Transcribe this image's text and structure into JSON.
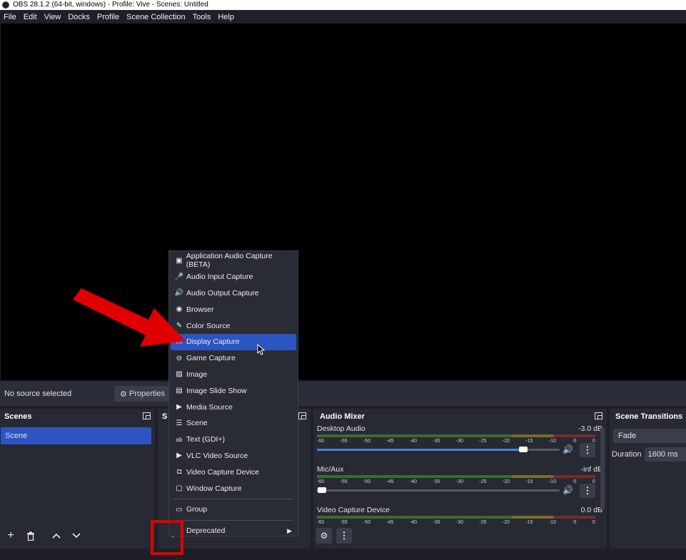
{
  "window": {
    "title": "OBS 28.1.2 (64-bit, windows) - Profile: Vive - Scenes: Untitled"
  },
  "menubar": {
    "items": [
      "File",
      "Edit",
      "View",
      "Docks",
      "Profile",
      "Scene Collection",
      "Tools",
      "Help"
    ]
  },
  "source_bar": {
    "status": "No source selected",
    "properties_label": "Properties"
  },
  "scenes": {
    "title": "Scenes",
    "items": [
      "Scene"
    ]
  },
  "sources": {
    "title_partial": "S"
  },
  "audio_mixer": {
    "title": "Audio Mixer",
    "ticks": [
      "-60",
      "-55",
      "-50",
      "-45",
      "-40",
      "-35",
      "-30",
      "-25",
      "-20",
      "-15",
      "-10",
      "-5",
      "0"
    ],
    "channels": [
      {
        "name": "Desktop Audio",
        "db": "-3.0 dB",
        "volume": 0.85
      },
      {
        "name": "Mic/Aux",
        "db": "-inf dB",
        "volume": 0.02
      },
      {
        "name": "Video Capture Device",
        "db": "0.0 dB",
        "volume": 1.0
      }
    ]
  },
  "transitions": {
    "title": "Scene Transitions",
    "selected": "Fade",
    "duration_label": "Duration",
    "duration_value": "1600 ms"
  },
  "add_source_menu": {
    "items": [
      {
        "label": "Application Audio Capture (BETA)",
        "icon": "app-audio-icon"
      },
      {
        "label": "Audio Input Capture",
        "icon": "microphone-icon"
      },
      {
        "label": "Audio Output Capture",
        "icon": "speaker-icon"
      },
      {
        "label": "Browser",
        "icon": "globe-icon"
      },
      {
        "label": "Color Source",
        "icon": "brush-icon"
      },
      {
        "label": "Display Capture",
        "icon": "monitor-icon",
        "active": true
      },
      {
        "label": "Game Capture",
        "icon": "gamepad-icon"
      },
      {
        "label": "Image",
        "icon": "image-icon"
      },
      {
        "label": "Image Slide Show",
        "icon": "slideshow-icon"
      },
      {
        "label": "Media Source",
        "icon": "play-icon"
      },
      {
        "label": "Scene",
        "icon": "list-icon"
      },
      {
        "label": "Text (GDI+)",
        "icon": "text-icon"
      },
      {
        "label": "VLC Video Source",
        "icon": "play-icon"
      },
      {
        "label": "Video Capture Device",
        "icon": "camera-icon"
      },
      {
        "label": "Window Capture",
        "icon": "window-icon"
      }
    ],
    "group_label": "Group",
    "deprecated_label": "Deprecated"
  },
  "colors": {
    "accent": "#2c54c2",
    "highlight": "#e00000",
    "background": "#1f2027",
    "panel": "#272a33"
  }
}
